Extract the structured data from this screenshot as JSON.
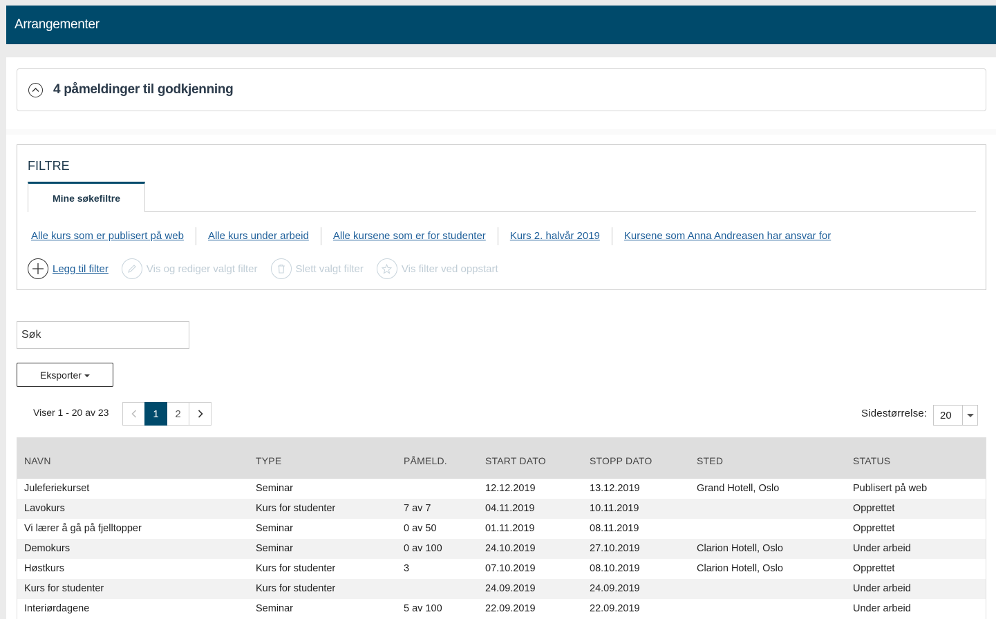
{
  "header": {
    "title": "Arrangementer"
  },
  "approval": {
    "title": "4 påmeldinger til godkjenning"
  },
  "filters": {
    "title": "FILTRE",
    "tab_label": "Mine søkefiltre",
    "saved": [
      "Alle kurs som er publisert på web",
      "Alle kurs under arbeid",
      "Alle kursene som er for studenter",
      "Kurs 2. halvår 2019",
      "Kursene som Anna Andreasen har ansvar for"
    ],
    "actions": {
      "add": "Legg til filter",
      "edit": "Vis og rediger valgt filter",
      "delete": "Slett valgt filter",
      "startup": "Vis filter ved oppstart"
    }
  },
  "search": {
    "placeholder": "Søk"
  },
  "export": {
    "label": "Eksporter"
  },
  "pagination": {
    "showing": "Viser 1 - 20 av 23",
    "pages": [
      "1",
      "2"
    ],
    "current": "1",
    "page_size_label": "Sidestørrelse:",
    "page_size": "20"
  },
  "table": {
    "columns": [
      "NAVN",
      "TYPE",
      "PÅMELD.",
      "START DATO",
      "STOPP DATO",
      "STED",
      "STATUS"
    ],
    "rows": [
      [
        "Juleferiekurset",
        "Seminar",
        "",
        "12.12.2019",
        "13.12.2019",
        "Grand Hotell, Oslo",
        "Publisert på web"
      ],
      [
        "Lavokurs",
        "Kurs for studenter",
        "7 av 7",
        "04.11.2019",
        "10.11.2019",
        "",
        "Opprettet"
      ],
      [
        "Vi lærer å gå på fjelltopper",
        "Seminar",
        "0 av 50",
        "01.11.2019",
        "08.11.2019",
        "",
        "Opprettet"
      ],
      [
        "Demokurs",
        "Seminar",
        "0 av 100",
        "24.10.2019",
        "27.10.2019",
        "Clarion Hotell, Oslo",
        "Under arbeid"
      ],
      [
        "Høstkurs",
        "Kurs for studenter",
        "3",
        "07.10.2019",
        "08.10.2019",
        "Clarion Hotell, Oslo",
        "Opprettet"
      ],
      [
        "Kurs for studenter",
        "Kurs for studenter",
        "",
        "24.09.2019",
        "24.09.2019",
        "",
        "Under arbeid"
      ],
      [
        "Interiørdagene",
        "Seminar",
        "5 av 100",
        "22.09.2019",
        "22.09.2019",
        "",
        "Under arbeid"
      ]
    ]
  }
}
